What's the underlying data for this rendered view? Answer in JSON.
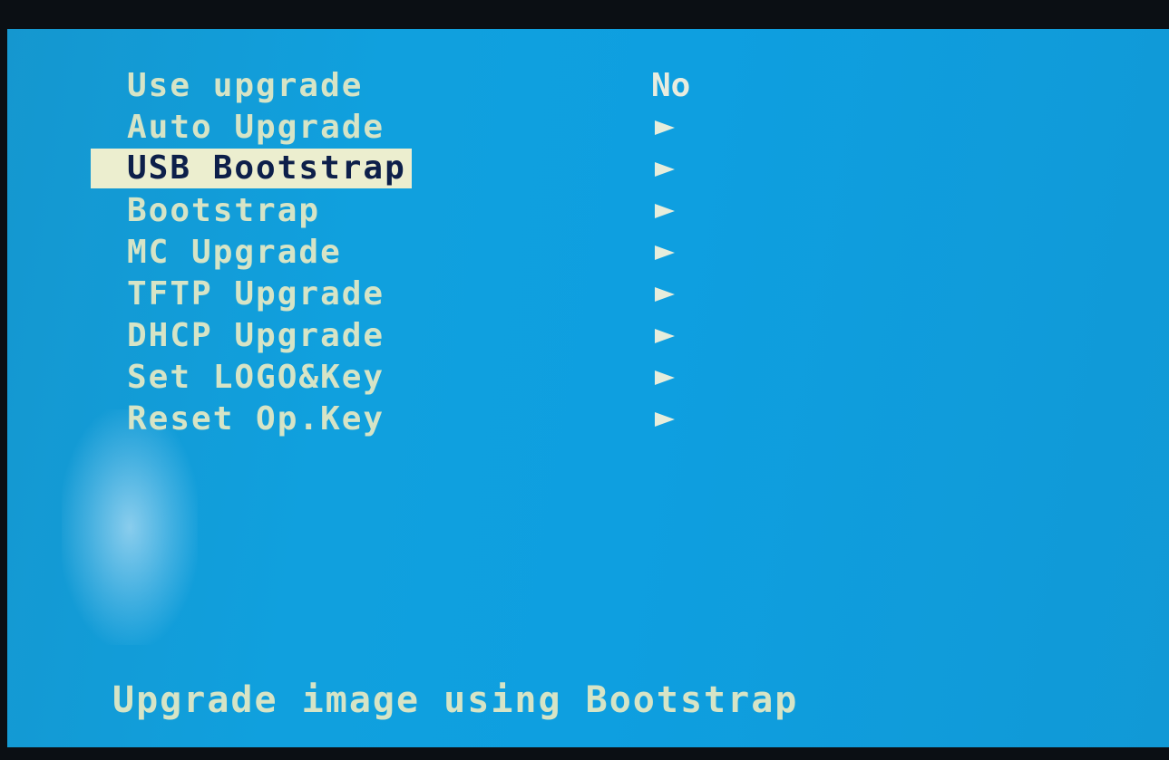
{
  "menu": {
    "items": [
      {
        "label": "Use upgrade",
        "value": "No",
        "arrow": false,
        "selected": false
      },
      {
        "label": "Auto Upgrade",
        "value": "",
        "arrow": true,
        "selected": false
      },
      {
        "label": "USB Bootstrap",
        "value": "",
        "arrow": true,
        "selected": true
      },
      {
        "label": "Bootstrap",
        "value": "",
        "arrow": true,
        "selected": false
      },
      {
        "label": "MC Upgrade",
        "value": "",
        "arrow": true,
        "selected": false
      },
      {
        "label": "TFTP Upgrade",
        "value": "",
        "arrow": true,
        "selected": false
      },
      {
        "label": "DHCP Upgrade",
        "value": "",
        "arrow": true,
        "selected": false
      },
      {
        "label": "Set LOGO&Key",
        "value": "",
        "arrow": true,
        "selected": false
      },
      {
        "label": "Reset Op.Key",
        "value": "",
        "arrow": true,
        "selected": false
      }
    ]
  },
  "status": {
    "text": "Upgrade image using Bootstrap"
  },
  "colors": {
    "background": "#0e9fe0",
    "text": "#d6e4c6",
    "highlight_background": "#eceecf",
    "highlight_text": "#0d1f4a"
  },
  "icons": {
    "submenu": "triangle-right-icon"
  }
}
